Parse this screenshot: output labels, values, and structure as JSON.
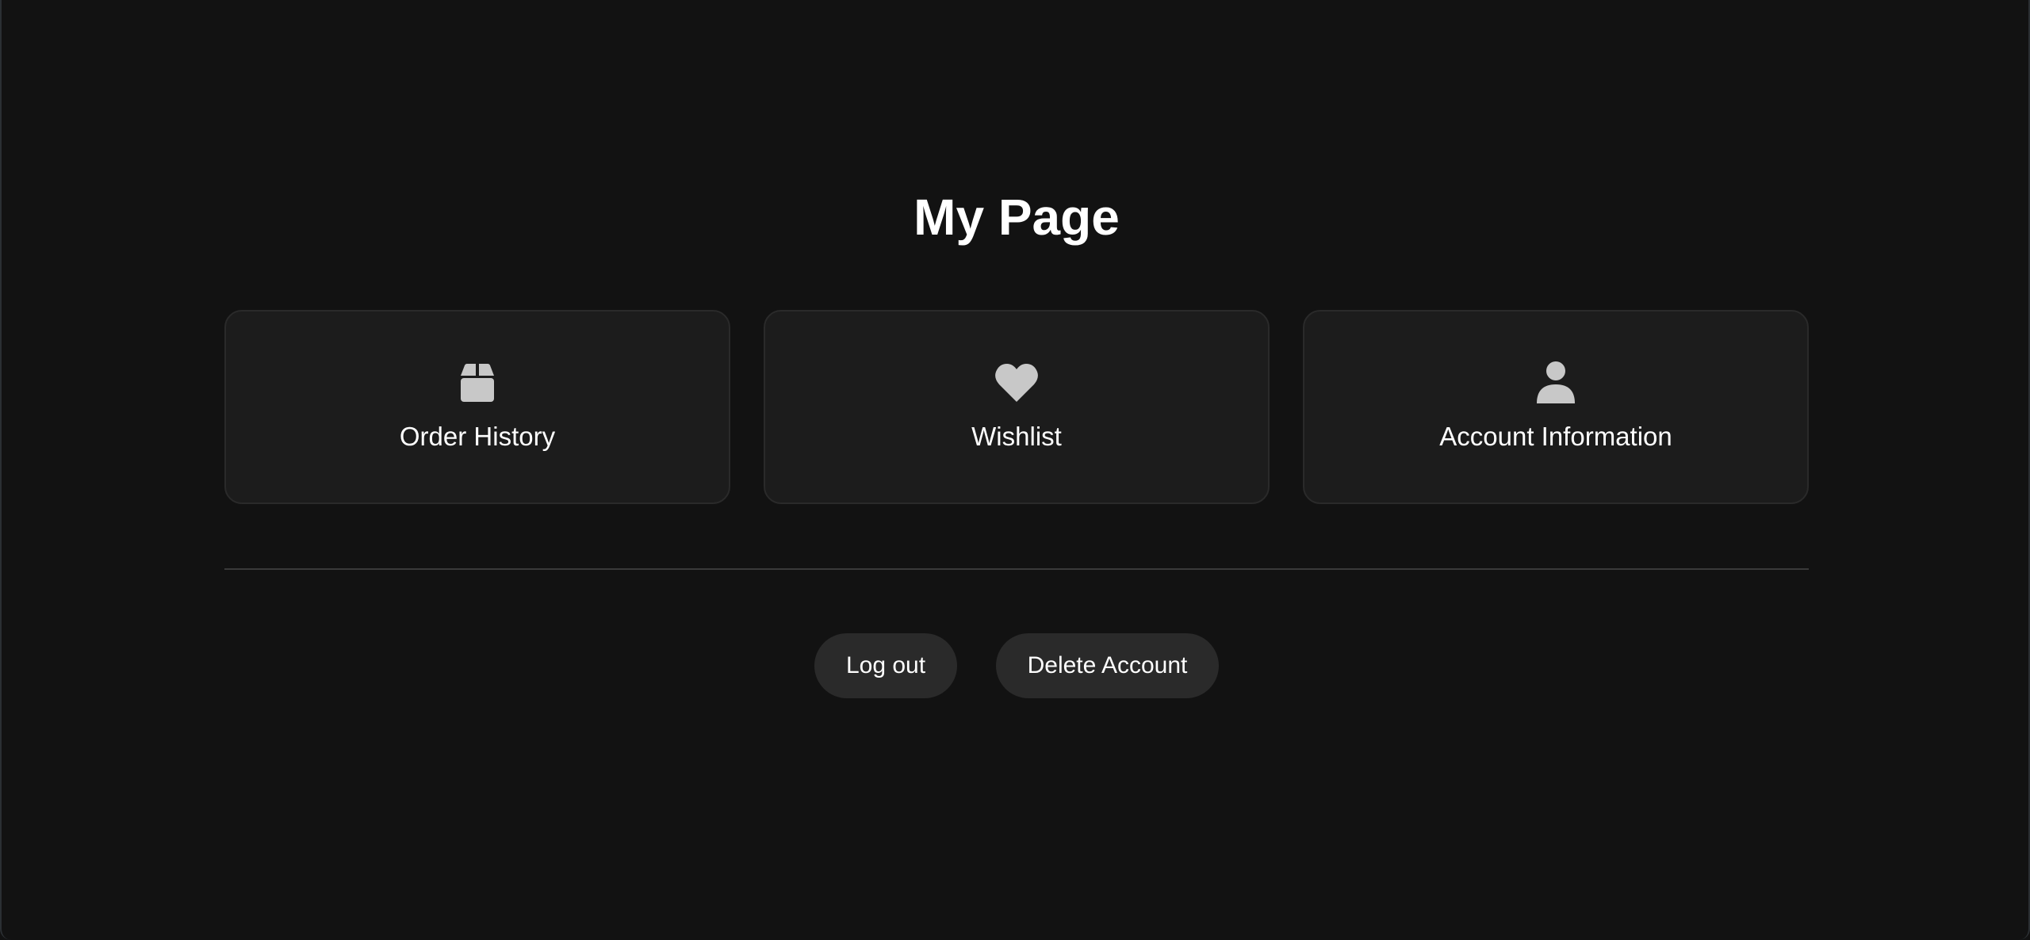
{
  "page": {
    "title": "My Page"
  },
  "cards": [
    {
      "label": "Order History",
      "icon": "box-icon"
    },
    {
      "label": "Wishlist",
      "icon": "heart-icon"
    },
    {
      "label": "Account Information",
      "icon": "user-icon"
    }
  ],
  "actions": {
    "logout_label": "Log out",
    "delete_label": "Delete Account"
  },
  "colors": {
    "background": "#121212",
    "card_background": "#1c1c1c",
    "card_border": "#2a2a2a",
    "button_background": "#2a2a2a",
    "icon": "#c8c8c8",
    "text": "#ffffff"
  }
}
